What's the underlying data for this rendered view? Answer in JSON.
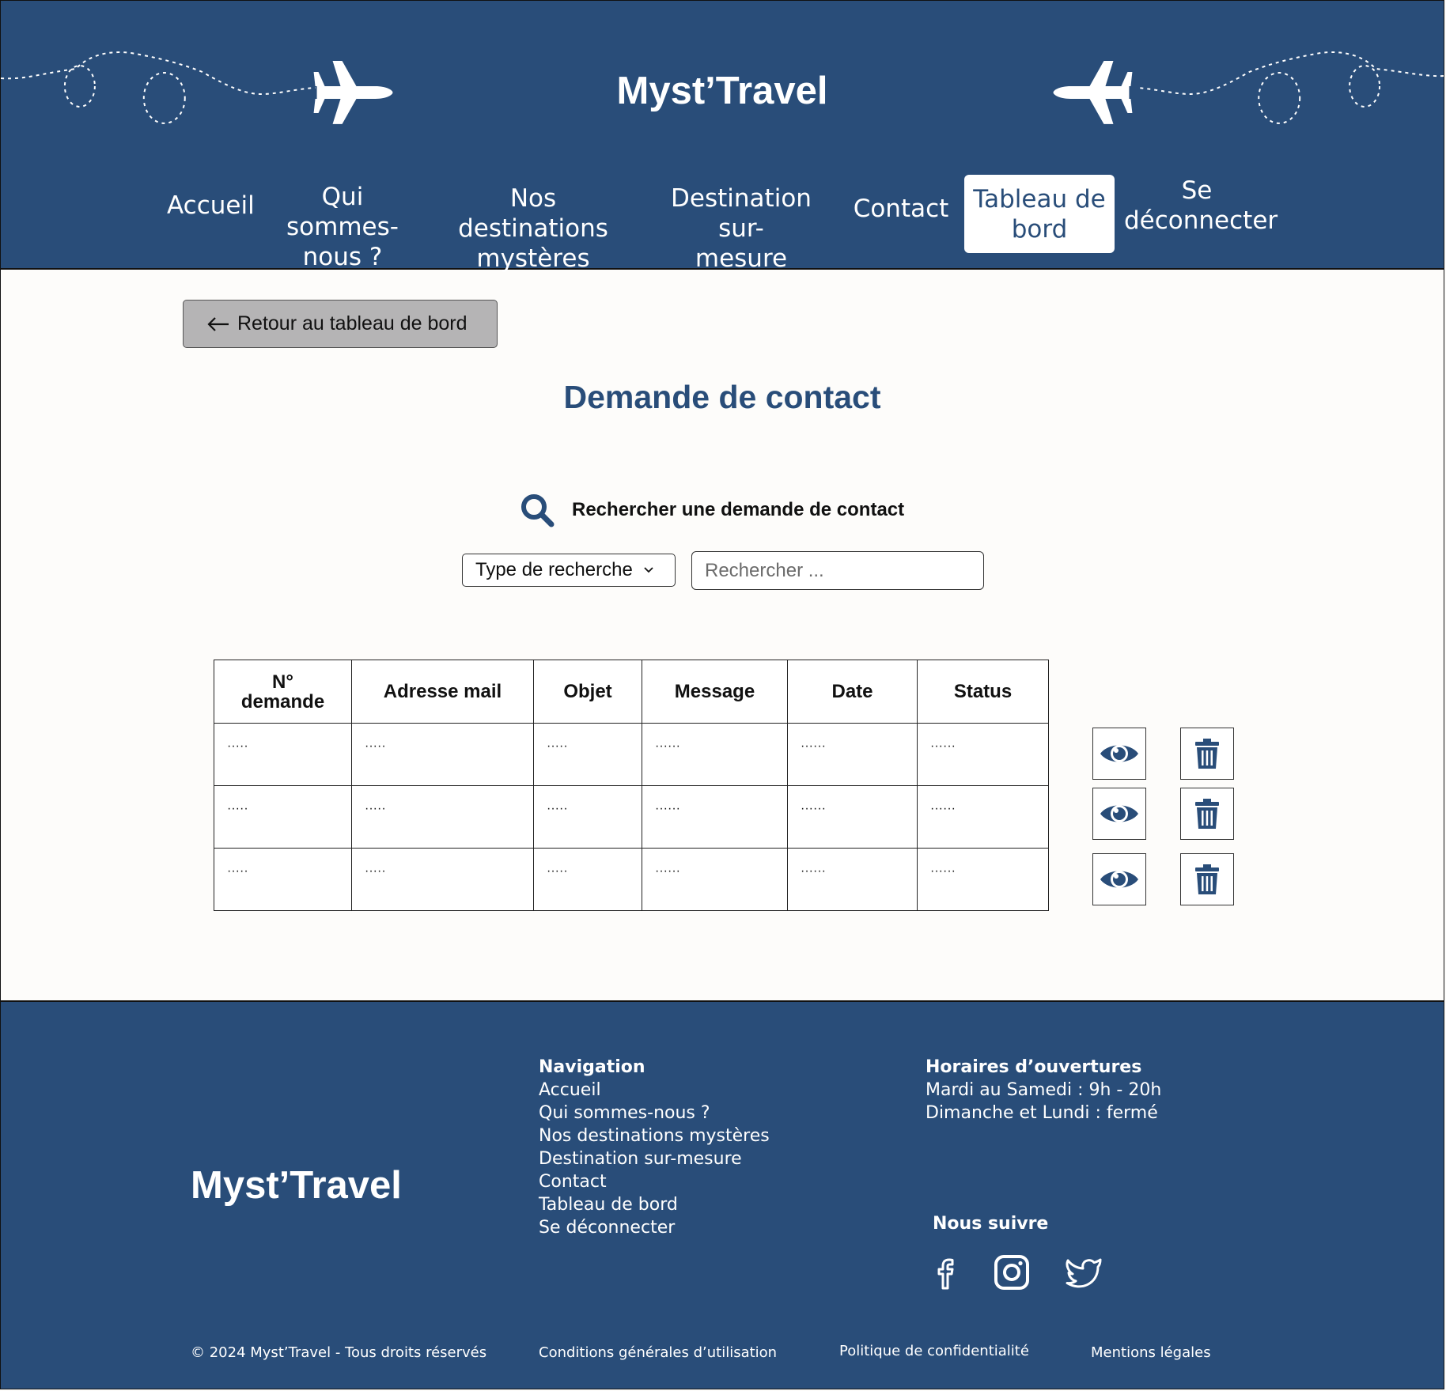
{
  "header": {
    "site_title": "Myst’Travel",
    "nav": {
      "accueil": "Accueil",
      "qui_1": "Qui sommes-",
      "qui_2": "nous ?",
      "dest_1": "Nos destinations",
      "dest_2": "mystères",
      "sur_1": "Destination sur-",
      "sur_2": "mesure",
      "contact": "Contact",
      "tableau_1": "Tableau de",
      "tableau_2": "bord",
      "deco_1": "Se",
      "deco_2": "déconnecter"
    }
  },
  "main": {
    "back_button": "Retour au tableau de bord",
    "heading": "Demande de contact",
    "search_label": "Rechercher une demande de contact",
    "search_type_select": "Type de recherche",
    "search_placeholder": "Rechercher ...",
    "table": {
      "headers": {
        "num_1": "N°",
        "num_2": "demande",
        "email": "Adresse mail",
        "objet": "Objet",
        "message": "Message",
        "date": "Date",
        "status": "Status"
      },
      "rows": [
        [
          "·····",
          "·····",
          "·····",
          "······",
          "······",
          "······"
        ],
        [
          "·····",
          "·····",
          "·····",
          "······",
          "······",
          "······"
        ],
        [
          "·····",
          "·····",
          "·····",
          "······",
          "······",
          "······"
        ]
      ]
    },
    "row_actions": [
      "eye-icon",
      "trash-icon"
    ]
  },
  "footer": {
    "logo": "Myst’Travel",
    "navigation": {
      "title": "Navigation",
      "items": [
        "Accueil",
        "Qui sommes-nous ?",
        "Nos destinations mystères",
        "Destination sur-mesure",
        "Contact",
        "Tableau de bord",
        "Se déconnecter"
      ]
    },
    "hours": {
      "title": "Horaires d’ouvertures",
      "line_1": "Mardi au Samedi : 9h - 20h",
      "line_2": "Dimanche et Lundi : fermé"
    },
    "follow": {
      "title": "Nous suivre",
      "icons": [
        "facebook-icon",
        "instagram-icon",
        "twitter-icon"
      ]
    },
    "copyright": "© 2024 Myst’Travel - Tous droits réservés",
    "cgu": "Conditions générales d’utilisation",
    "privacy": "Politique de confidentialité",
    "legal": "Mentions légales"
  },
  "colors": {
    "brand_blue": "#294d79",
    "page_background": "#fdfcfa",
    "back_button_gray": "#b5b4b5"
  }
}
